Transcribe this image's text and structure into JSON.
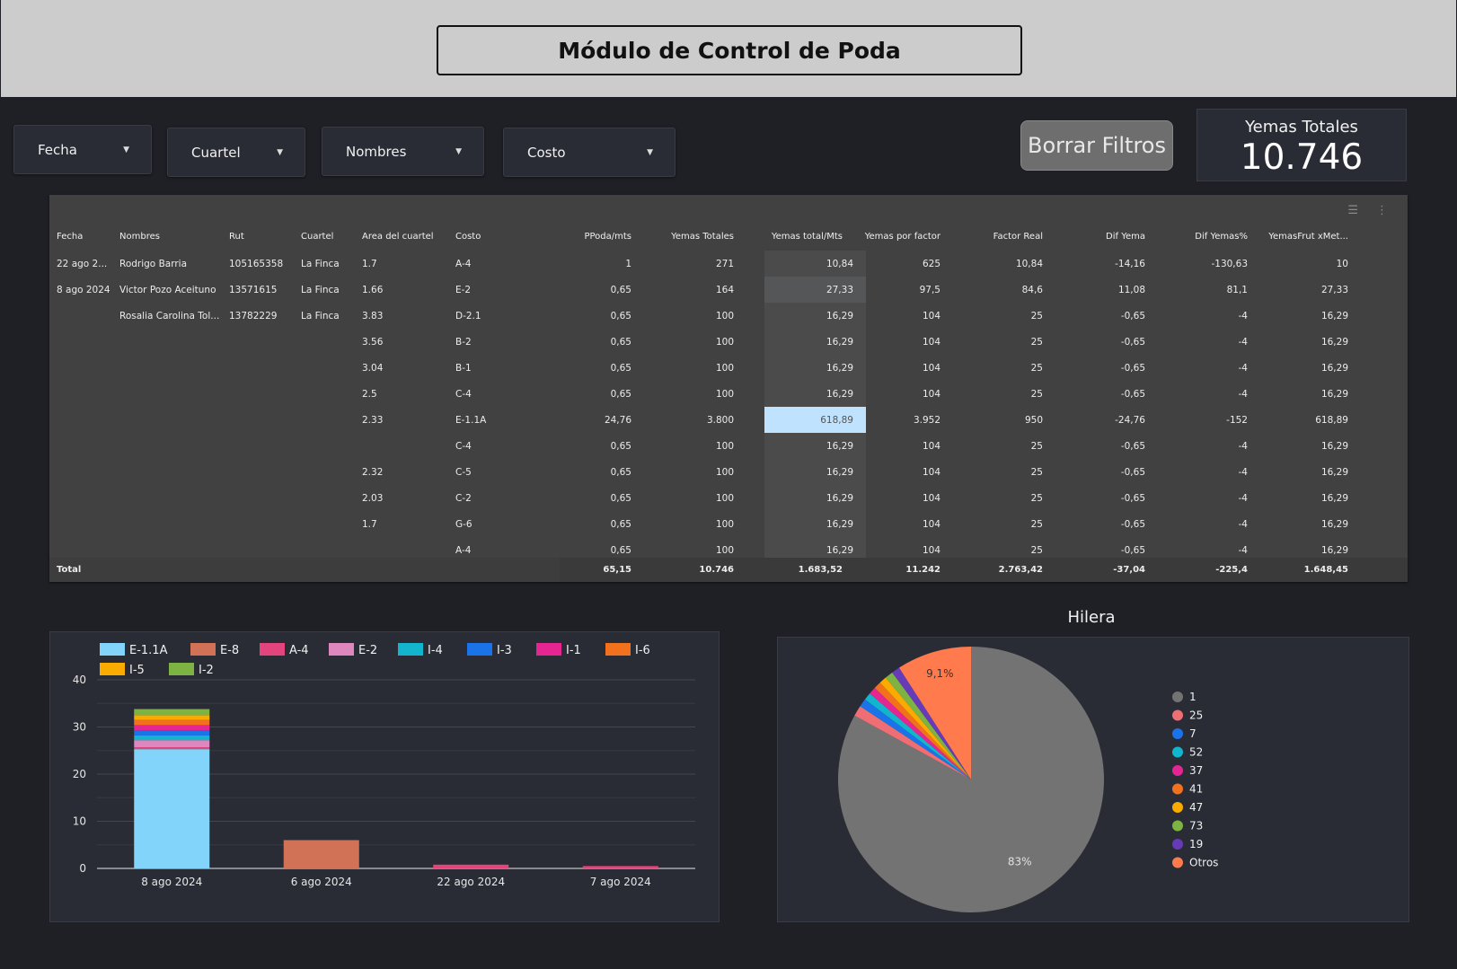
{
  "header": {
    "title": "Módulo de Control de Poda"
  },
  "filters": [
    {
      "label": "Fecha"
    },
    {
      "label": "Cuartel"
    },
    {
      "label": "Nombres"
    },
    {
      "label": "Costo"
    }
  ],
  "clear_button": "Borrar Filtros",
  "kpi": {
    "label": "Yemas Totales",
    "value": "10.746"
  },
  "table": {
    "columns": [
      "Fecha",
      "Nombres",
      "Rut",
      "Cuartel",
      "Area del cuartel",
      "Costo",
      "PPoda/mts",
      "Yemas Totales",
      "Yemas total/Mts",
      "Yemas por factor",
      "Factor Real",
      "Dif Yema",
      "Dif Yemas%",
      "YemasFrut xMet..."
    ],
    "rows": [
      [
        "22 ago 2...",
        "Rodrigo Barria",
        "105165358",
        "La Finca",
        "1.7",
        "A-4",
        "1",
        "271",
        "10,84",
        "625",
        "10,84",
        "-14,16",
        "-130,63",
        "10"
      ],
      [
        "8 ago 2024",
        "Victor Pozo Aceituno",
        "13571615",
        "La Finca",
        "1.66",
        "E-2",
        "0,65",
        "164",
        "27,33",
        "97,5",
        "84,6",
        "11,08",
        "81,1",
        "27,33"
      ],
      [
        "",
        "Rosalia Carolina Tol...",
        "13782229",
        "La Finca",
        "3.83",
        "D-2.1",
        "0,65",
        "100",
        "16,29",
        "104",
        "25",
        "-0,65",
        "-4",
        "16,29"
      ],
      [
        "",
        "",
        "",
        "",
        "3.56",
        "B-2",
        "0,65",
        "100",
        "16,29",
        "104",
        "25",
        "-0,65",
        "-4",
        "16,29"
      ],
      [
        "",
        "",
        "",
        "",
        "3.04",
        "B-1",
        "0,65",
        "100",
        "16,29",
        "104",
        "25",
        "-0,65",
        "-4",
        "16,29"
      ],
      [
        "",
        "",
        "",
        "",
        "2.5",
        "C-4",
        "0,65",
        "100",
        "16,29",
        "104",
        "25",
        "-0,65",
        "-4",
        "16,29"
      ],
      [
        "",
        "",
        "",
        "",
        "2.33",
        "E-1.1A",
        "24,76",
        "3.800",
        "618,89",
        "3.952",
        "950",
        "-24,76",
        "-152",
        "618,89"
      ],
      [
        "",
        "",
        "",
        "",
        "",
        "C-4",
        "0,65",
        "100",
        "16,29",
        "104",
        "25",
        "-0,65",
        "-4",
        "16,29"
      ],
      [
        "",
        "",
        "",
        "",
        "2.32",
        "C-5",
        "0,65",
        "100",
        "16,29",
        "104",
        "25",
        "-0,65",
        "-4",
        "16,29"
      ],
      [
        "",
        "",
        "",
        "",
        "2.03",
        "C-2",
        "0,65",
        "100",
        "16,29",
        "104",
        "25",
        "-0,65",
        "-4",
        "16,29"
      ],
      [
        "",
        "",
        "",
        "",
        "1.7",
        "G-6",
        "0,65",
        "100",
        "16,29",
        "104",
        "25",
        "-0,65",
        "-4",
        "16,29"
      ],
      [
        "",
        "",
        "",
        "",
        "",
        "A-4",
        "0,65",
        "100",
        "16,29",
        "104",
        "25",
        "-0,65",
        "-4",
        "16,29"
      ]
    ],
    "total": [
      "Total",
      "",
      "",
      "",
      "",
      "",
      "65,15",
      "10.746",
      "1.683,52",
      "11.242",
      "2.763,42",
      "-37,04",
      "-225,4",
      "1.648,45"
    ]
  },
  "chart_data": [
    {
      "type": "bar",
      "stacked": true,
      "categories": [
        "8 ago 2024",
        "6 ago 2024",
        "22 ago 2024",
        "7 ago 2024"
      ],
      "ylim": [
        0,
        40
      ],
      "yticks": [
        0,
        10,
        20,
        30,
        40
      ],
      "legend_position": "top-left",
      "series": [
        {
          "name": "E-1.1A",
          "color": "#82d4fb",
          "values": [
            25.3,
            0,
            0,
            0
          ]
        },
        {
          "name": "E-8",
          "color": "#d17257",
          "values": [
            0,
            6.0,
            0,
            0
          ]
        },
        {
          "name": "A-4",
          "color": "#e3447c",
          "values": [
            0.4,
            0,
            0.8,
            0.5
          ]
        },
        {
          "name": "E-2",
          "color": "#de87bf",
          "values": [
            1.5,
            0,
            0,
            0
          ]
        },
        {
          "name": "I-4",
          "color": "#12b5cb",
          "values": [
            1.0,
            0,
            0,
            0
          ]
        },
        {
          "name": "I-3",
          "color": "#1a73e8",
          "values": [
            1.1,
            0,
            0,
            0
          ]
        },
        {
          "name": "I-1",
          "color": "#e52592",
          "values": [
            1.1,
            0,
            0,
            0
          ]
        },
        {
          "name": "I-6",
          "color": "#f2711c",
          "values": [
            1.1,
            0,
            0,
            0
          ]
        },
        {
          "name": "I-5",
          "color": "#f9ab00",
          "values": [
            1.0,
            0,
            0,
            0
          ]
        },
        {
          "name": "I-2",
          "color": "#7cb342",
          "values": [
            1.3,
            0,
            0,
            0
          ]
        }
      ]
    },
    {
      "type": "pie",
      "title": "Hilera",
      "legend_position": "right",
      "slices": [
        {
          "name": "1",
          "value": 83,
          "color": "#737373",
          "label": "83%"
        },
        {
          "name": "25",
          "value": 1.3,
          "color": "#ee6e73"
        },
        {
          "name": "7",
          "value": 1.0,
          "color": "#1a73e8"
        },
        {
          "name": "52",
          "value": 0.9,
          "color": "#12b5cb"
        },
        {
          "name": "37",
          "value": 0.9,
          "color": "#e52592"
        },
        {
          "name": "41",
          "value": 0.9,
          "color": "#f2711c"
        },
        {
          "name": "47",
          "value": 0.9,
          "color": "#f9ab00"
        },
        {
          "name": "73",
          "value": 1.0,
          "color": "#7cb342"
        },
        {
          "name": "19",
          "value": 1.0,
          "color": "#673ab7"
        },
        {
          "name": "Otros",
          "value": 9.1,
          "color": "#ff7a4d",
          "label": "9,1%"
        }
      ]
    }
  ]
}
